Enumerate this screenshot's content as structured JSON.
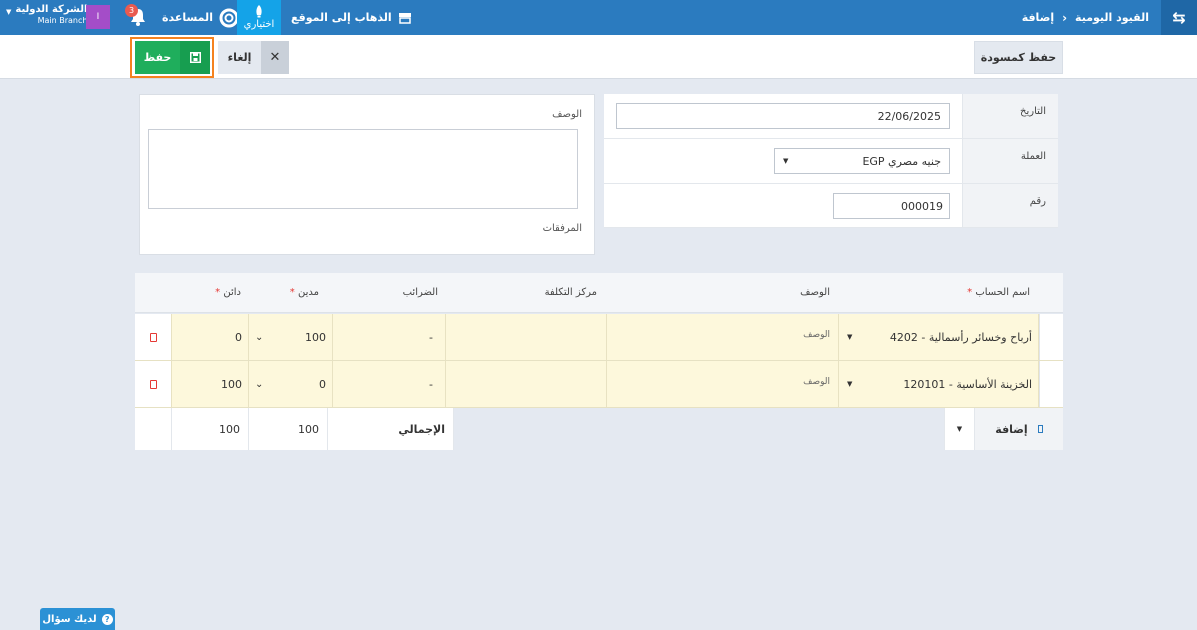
{
  "topbar": {
    "menu_icon": "menu-toggle-icon",
    "breadcrumb": [
      "القيود اليومية",
      "إضافة"
    ],
    "company_name": "الشركة الدولية",
    "branch_name": "Main Branch",
    "user_initial": "I",
    "notification_count": "3",
    "help_label": "المساعدة",
    "shortcuts_label": "اختياري",
    "site_label": "الذهاب إلى الموقع",
    "bar_color": "#2b7bbf"
  },
  "actions": {
    "save_label": "حفظ",
    "cancel_label": "إلغاء",
    "draft_label": "حفظ كمسودة",
    "save_color": "#1fae5c",
    "highlight_color": "#f5821f"
  },
  "description_panel": {
    "description_label": "الوصف",
    "description_value": "",
    "attachments_label": "المرفقات"
  },
  "fields": {
    "date_label": "التاريخ",
    "date_value": "22/06/2025",
    "currency_label": "العملة",
    "currency_value": "EGP جنيه مصري",
    "number_label": "رقم",
    "number_value": "000019"
  },
  "grid": {
    "headers": {
      "account": "اسم الحساب",
      "description": "الوصف",
      "cost_center": "مركز التكلفة",
      "taxes": "الضرائب",
      "debit": "مدين",
      "credit": "دائن"
    },
    "rows": [
      {
        "account": "4202 - أرباح وخسائر رأسمالية",
        "description_placeholder": "الوصف",
        "cost_center": "",
        "tax": "-",
        "debit": "100",
        "credit": "0"
      },
      {
        "account": "120101 - الخزينة الأساسية",
        "description_placeholder": "الوصف",
        "cost_center": "",
        "tax": "-",
        "debit": "0",
        "credit": "100"
      }
    ],
    "footer": {
      "total_label": "الإجمالي",
      "total_debit": "100",
      "total_credit": "100",
      "add_label": "إضافة"
    }
  },
  "help_widget": {
    "label": "لديك سؤال"
  }
}
